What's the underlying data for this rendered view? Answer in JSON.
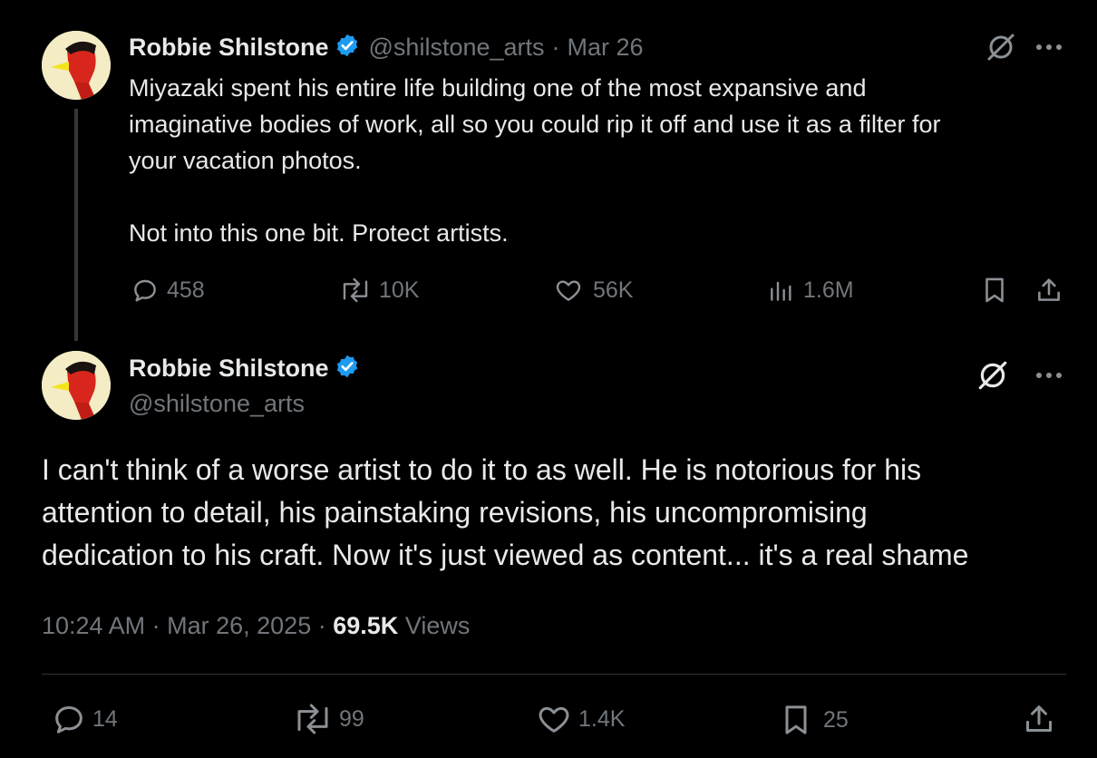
{
  "colors": {
    "background": "#000000",
    "text": "#e7e9ea",
    "muted": "#71767b",
    "verified": "#1d9bf0",
    "divider": "#2f3336"
  },
  "parent_tweet": {
    "author_name": "Robbie Shilstone",
    "handle": "@shilstone_arts",
    "separator": "·",
    "date": "Mar 26",
    "text_lines": [
      "Miyazaki spent his entire life building one of the most expansive and",
      "imaginative bodies of work, all so you could rip it off and use it as a filter for",
      "your vacation photos."
    ],
    "text_para2": "Not into this one bit. Protect artists.",
    "replies": "458",
    "reposts": "10K",
    "likes": "56K",
    "views": "1.6M",
    "icons": [
      "grok-icon",
      "more-icon",
      "reply-icon",
      "repost-icon",
      "like-icon",
      "views-icon",
      "bookmark-icon",
      "share-icon"
    ]
  },
  "main_tweet": {
    "author_name": "Robbie Shilstone",
    "handle": "@shilstone_arts",
    "text_lines": [
      "I can't think of a worse artist to do it to as well. He is notorious for his",
      "attention to detail, his painstaking revisions, his uncompromising",
      "dedication to his craft. Now it's just viewed as content... it's a real shame"
    ],
    "time": "10:24 AM",
    "sep1": "·",
    "date": "Mar 26, 2025",
    "sep2": "·",
    "views_count": "69.5K",
    "views_label": "Views",
    "replies": "14",
    "reposts": "99",
    "likes": "1.4K",
    "bookmarks": "25"
  }
}
